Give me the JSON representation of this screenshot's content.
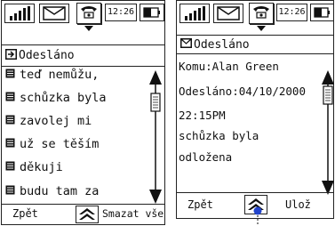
{
  "left": {
    "status": {
      "time": "12:26"
    },
    "title": "Odesláno",
    "messages": [
      "teď nemůžu,",
      "schůzka byla",
      "zavolej mi",
      "už se těším",
      "děkuji",
      "budu tam za"
    ],
    "softkeys": {
      "left": "Zpět",
      "right": "Smazat vše"
    }
  },
  "right": {
    "status": {
      "time": "12:26"
    },
    "title": "Odesláno",
    "to_line": "Komu:Alan Green",
    "sent_line": "Odesláno:04/10/2000",
    "time_line": "22:15PM",
    "body_lines": [
      "schůzka byla",
      "odložena"
    ],
    "softkeys": {
      "left": "Zpět",
      "right": "Ulož"
    }
  }
}
